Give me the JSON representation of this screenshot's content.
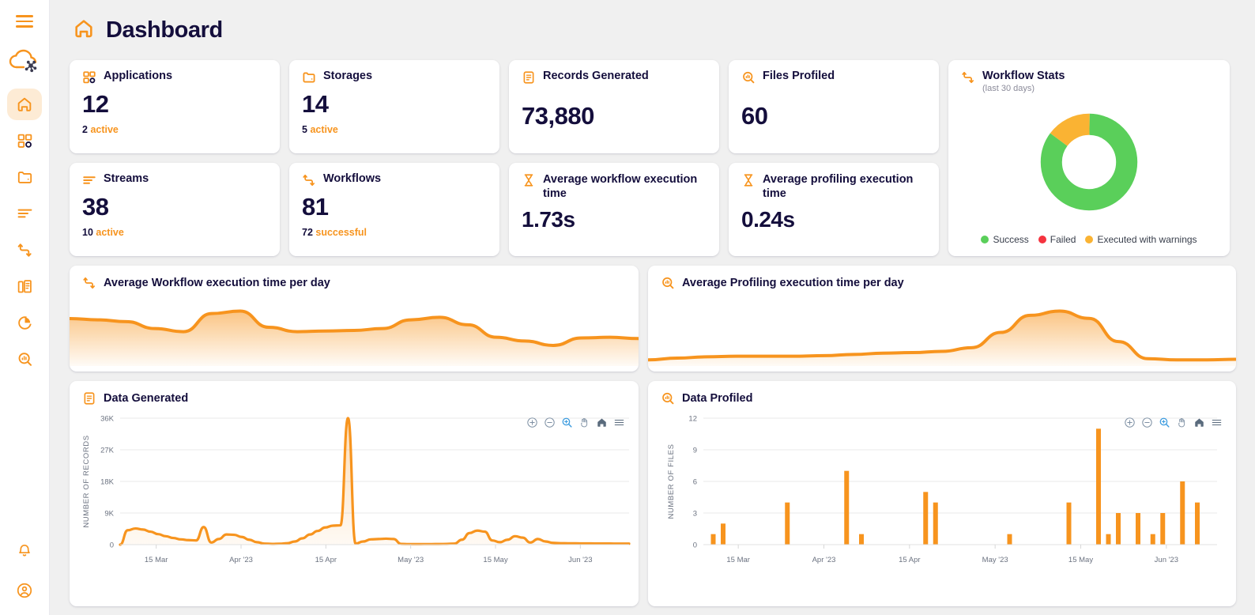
{
  "sidebar": {
    "menu_icon": "hamburger-icon",
    "logo_icon": "cloud-network-logo",
    "items": [
      {
        "name": "home",
        "icon": "home-icon",
        "active": true
      },
      {
        "name": "applications",
        "icon": "applications-grid-icon",
        "active": false
      },
      {
        "name": "storages",
        "icon": "folder-icon",
        "active": false
      },
      {
        "name": "streams",
        "icon": "streams-lines-icon",
        "active": false
      },
      {
        "name": "workflows",
        "icon": "workflow-arrow-icon",
        "active": false
      },
      {
        "name": "records",
        "icon": "documents-icon",
        "active": false
      },
      {
        "name": "reports",
        "icon": "pie-chart-icon",
        "active": false
      },
      {
        "name": "profiling",
        "icon": "search-chart-icon",
        "active": false
      }
    ],
    "bottom_items": [
      {
        "name": "notifications",
        "icon": "bell-icon"
      },
      {
        "name": "account",
        "icon": "user-circle-icon"
      }
    ]
  },
  "header": {
    "title": "Dashboard",
    "icon": "home-icon"
  },
  "colors": {
    "orange": "#F7941E",
    "navy": "#140e3c",
    "green": "#5ACF5A",
    "red": "#F5333F",
    "amber": "#FAB333",
    "accent_blue": "#3B9BDF"
  },
  "stats": [
    {
      "name": "applications",
      "icon": "applications-grid-icon",
      "title": "Applications",
      "value": "12",
      "foot_number": "2",
      "foot_label": "active"
    },
    {
      "name": "storages",
      "icon": "folder-icon",
      "title": "Storages",
      "value": "14",
      "foot_number": "5",
      "foot_label": "active"
    },
    {
      "name": "records-generated",
      "icon": "records-icon",
      "title": "Records Generated",
      "value": "73,880",
      "foot_number": "",
      "foot_label": ""
    },
    {
      "name": "files-profiled",
      "icon": "search-chart-icon",
      "title": "Files Profiled",
      "value": "60",
      "foot_number": "",
      "foot_label": ""
    },
    {
      "name": "streams",
      "icon": "streams-lines-icon",
      "title": "Streams",
      "value": "38",
      "foot_number": "10",
      "foot_label": "active"
    },
    {
      "name": "workflows",
      "icon": "workflow-arrow-icon",
      "title": "Workflows",
      "value": "81",
      "foot_number": "72",
      "foot_label": "successful"
    },
    {
      "name": "average-workflow-execution-time",
      "icon": "hourglass-icon",
      "title": "Average workflow execution time",
      "value": "1.73s",
      "foot_number": "",
      "foot_label": ""
    },
    {
      "name": "average-profiling-execution-time",
      "icon": "hourglass-icon",
      "title": "Average profiling execution time",
      "value": "0.24s",
      "foot_number": "",
      "foot_label": ""
    }
  ],
  "workflow_stats": {
    "title": "Workflow Stats",
    "subtitle": "(last 30 days)",
    "icon": "workflow-arrow-icon",
    "chart_data": {
      "type": "pie",
      "title": "Workflow Stats",
      "labels": [
        "Success",
        "Failed",
        "Executed with warnings"
      ],
      "values": [
        85,
        0,
        15
      ],
      "colors": [
        "#5ACF5A",
        "#F5333F",
        "#FAB333"
      ],
      "legend_position": "bottom",
      "donut": true
    }
  },
  "area_charts": [
    {
      "name": "average-workflow-execution-time-per-day",
      "icon": "workflow-arrow-icon",
      "title": "Average Workflow execution time per day",
      "chart_data": {
        "type": "area",
        "title": "Average Workflow execution time per day",
        "xlabel": "",
        "ylabel": "",
        "grid": false,
        "x": [
          0,
          1,
          2,
          3,
          4,
          5,
          6,
          7,
          8,
          9,
          10,
          11,
          12,
          13,
          14,
          15,
          16,
          17,
          18,
          19,
          20
        ],
        "values": [
          0.76,
          0.74,
          0.71,
          0.6,
          0.55,
          0.84,
          0.88,
          0.62,
          0.55,
          0.56,
          0.57,
          0.6,
          0.74,
          0.78,
          0.66,
          0.46,
          0.4,
          0.33,
          0.45,
          0.46,
          0.44
        ]
      }
    },
    {
      "name": "average-profiling-execution-time-per-day",
      "icon": "search-chart-icon",
      "title": "Average Profiling execution time per day",
      "chart_data": {
        "type": "area",
        "title": "Average Profiling execution time per day",
        "xlabel": "",
        "ylabel": "",
        "grid": false,
        "x": [
          0,
          1,
          2,
          3,
          4,
          5,
          6,
          7,
          8,
          9,
          10,
          11,
          12,
          13,
          14,
          15,
          16,
          17,
          18,
          19,
          20
        ],
        "values": [
          0.1,
          0.13,
          0.15,
          0.16,
          0.16,
          0.16,
          0.17,
          0.19,
          0.21,
          0.22,
          0.24,
          0.3,
          0.55,
          0.83,
          0.9,
          0.78,
          0.4,
          0.12,
          0.1,
          0.1,
          0.11
        ]
      }
    }
  ],
  "data_generated": {
    "name": "data-generated",
    "icon": "records-icon",
    "title": "Data Generated",
    "toolbar": [
      {
        "name": "zoom-in-icon",
        "label": "Zoom In",
        "active": false
      },
      {
        "name": "zoom-out-icon",
        "label": "Zoom Out",
        "active": false
      },
      {
        "name": "selection-zoom-icon",
        "label": "Selection Zoom",
        "active": true
      },
      {
        "name": "pan-hand-icon",
        "label": "Panning",
        "active": false
      },
      {
        "name": "home-reset-icon",
        "label": "Reset Zoom",
        "active": false
      },
      {
        "name": "hamburger-menu-icon",
        "label": "Menu",
        "active": false
      }
    ],
    "chart_data": {
      "type": "area",
      "title": "Data Generated",
      "xlabel": "",
      "ylabel": "NUMBER OF RECORDS",
      "ylim": [
        0,
        36000
      ],
      "yticks": [
        0,
        9000,
        18000,
        27000,
        36000
      ],
      "ytick_labels": [
        "0",
        "9K",
        "18K",
        "27K",
        "36K"
      ],
      "xticks": [
        "15 Mar",
        "Apr '23",
        "15 Apr",
        "May '23",
        "15 May",
        "Jun '23"
      ],
      "grid": true,
      "values": [
        0,
        4100,
        4600,
        4300,
        3700,
        3000,
        2400,
        1900,
        1500,
        1300,
        1200,
        5000,
        600,
        1600,
        2900,
        2800,
        2200,
        1400,
        700,
        300,
        200,
        250,
        400,
        900,
        1800,
        2900,
        3900,
        4900,
        5400,
        5500,
        36000,
        300,
        900,
        1500,
        1600,
        1700,
        1600,
        200,
        150,
        140,
        150,
        160,
        170,
        200,
        300,
        1400,
        3300,
        4000,
        3700,
        1200,
        700,
        1400,
        2400,
        2000,
        600,
        1600,
        900,
        500,
        400,
        380,
        360,
        340,
        330,
        320,
        310,
        300,
        290,
        280
      ]
    }
  },
  "data_profiled": {
    "name": "data-profiled",
    "icon": "search-chart-icon",
    "title": "Data Profiled",
    "toolbar": [
      {
        "name": "zoom-in-icon",
        "label": "Zoom In",
        "active": false
      },
      {
        "name": "zoom-out-icon",
        "label": "Zoom Out",
        "active": false
      },
      {
        "name": "selection-zoom-icon",
        "label": "Selection Zoom",
        "active": true
      },
      {
        "name": "pan-hand-icon",
        "label": "Panning",
        "active": false
      },
      {
        "name": "home-reset-icon",
        "label": "Reset Zoom",
        "active": false
      },
      {
        "name": "hamburger-menu-icon",
        "label": "Menu",
        "active": false
      }
    ],
    "chart_data": {
      "type": "bar",
      "title": "Data Profiled",
      "xlabel": "",
      "ylabel": "NUMBER OF FILES",
      "ylim": [
        0,
        12
      ],
      "yticks": [
        0,
        3,
        6,
        9,
        12
      ],
      "ytick_labels": [
        "0",
        "3",
        "6",
        "9",
        "12"
      ],
      "xticks": [
        "15 Mar",
        "Apr '23",
        "15 Apr",
        "May '23",
        "15 May",
        "Jun '23"
      ],
      "grid": true,
      "bars": [
        {
          "pos": 2,
          "value": 1
        },
        {
          "pos": 4,
          "value": 2
        },
        {
          "pos": 17,
          "value": 4
        },
        {
          "pos": 29,
          "value": 7
        },
        {
          "pos": 32,
          "value": 1
        },
        {
          "pos": 45,
          "value": 5
        },
        {
          "pos": 47,
          "value": 4
        },
        {
          "pos": 62,
          "value": 1
        },
        {
          "pos": 74,
          "value": 4
        },
        {
          "pos": 80,
          "value": 11
        },
        {
          "pos": 82,
          "value": 1
        },
        {
          "pos": 84,
          "value": 3
        },
        {
          "pos": 88,
          "value": 3
        },
        {
          "pos": 91,
          "value": 1
        },
        {
          "pos": 93,
          "value": 3
        },
        {
          "pos": 97,
          "value": 6
        },
        {
          "pos": 100,
          "value": 4
        }
      ]
    }
  }
}
